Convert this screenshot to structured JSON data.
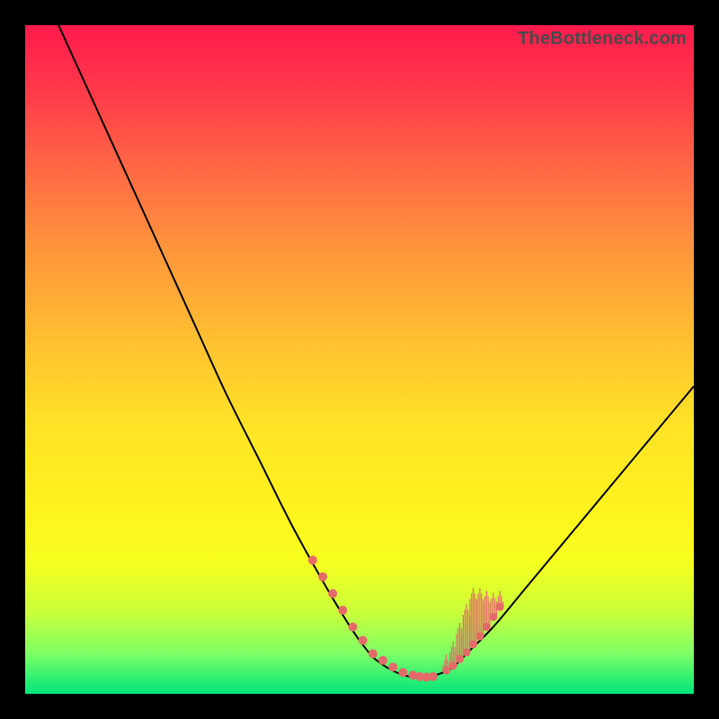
{
  "watermark": "TheBottleneck.com",
  "colors": {
    "background": "#000000",
    "curve": "#000000",
    "marker": "#e46a6a",
    "gradient_stops": [
      "#ff1a4d",
      "#ff3a4a",
      "#ff6a45",
      "#ff9a3a",
      "#ffc230",
      "#ffe326",
      "#fff21e",
      "#f7ff1e",
      "#c8ff3a",
      "#7dff66",
      "#00e57a"
    ]
  },
  "chart_data": {
    "type": "line",
    "title": "",
    "xlabel": "",
    "ylabel": "",
    "xlim": [
      0,
      100
    ],
    "ylim": [
      0,
      100
    ],
    "series": [
      {
        "name": "bottleneck-curve",
        "x": [
          5,
          10,
          15,
          20,
          25,
          30,
          35,
          40,
          45,
          48,
          50,
          52,
          54,
          56,
          58,
          60,
          62,
          64,
          66,
          70,
          75,
          80,
          85,
          90,
          95,
          100
        ],
        "y": [
          100,
          89,
          78,
          67,
          56,
          45,
          35,
          25,
          16,
          11,
          8,
          5.5,
          4,
          3,
          2.5,
          2.5,
          3,
          4,
          6,
          10,
          16,
          22,
          28,
          34,
          40,
          46
        ]
      }
    ],
    "markers_left": {
      "name": "left-cluster",
      "x": [
        43,
        44.5,
        46,
        47.5,
        49,
        50.5,
        52,
        53.5,
        55,
        56.5,
        58,
        59,
        60,
        61
      ],
      "y": [
        20,
        17.5,
        15,
        12.5,
        10,
        8,
        6,
        5,
        4,
        3.2,
        2.8,
        2.6,
        2.5,
        2.6
      ]
    },
    "markers_right_spikes": {
      "name": "right-cluster-spikes",
      "x": [
        63,
        64,
        65,
        66,
        67,
        68,
        69,
        70,
        71
      ],
      "y_base": [
        3.5,
        4.2,
        5.2,
        6.2,
        7.4,
        8.6,
        10,
        11.5,
        13
      ],
      "spike_height": [
        4,
        6,
        9,
        12,
        14,
        12,
        9,
        6,
        4
      ]
    }
  }
}
